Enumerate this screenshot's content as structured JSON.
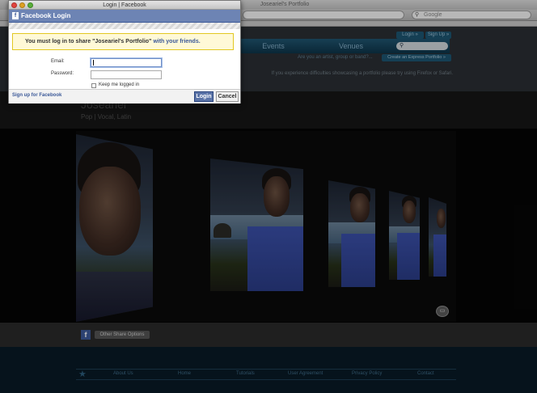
{
  "background": {
    "window_title": "Joseariel's Portfolio",
    "search_placeholder": "Google",
    "nav": {
      "events": "Events",
      "venues": "Venues"
    },
    "login_pill": "Login »",
    "signup_pill": "Sign Up »",
    "artist_prompt": "Are you an artist, group or band?...",
    "express_button": "Create an Express Portfolio »",
    "difficulties_text": "If you experience difficulties showcasing a portfolio please try using Firefox or Safari.",
    "profile_name": "Joseariel",
    "profile_genre": "Pop | Vocal, Latin",
    "share_options": "Other Share Options",
    "footer_links": [
      "About Us",
      "Home",
      "Tutorials",
      "User Agreement",
      "Privacy Policy",
      "Contact"
    ]
  },
  "popup": {
    "window_title": "Login | Facebook",
    "header_title": "Facebook Login",
    "notice_prefix": "You must log in to share \"Joseariel's Portfolio\"",
    "notice_link": "with your friends.",
    "email_label": "Email:",
    "password_label": "Password:",
    "email_value": "",
    "password_value": "",
    "keep_logged_in": "Keep me logged in",
    "signup_link": "Sign up for Facebook",
    "login_button": "Login",
    "cancel_button": "Cancel"
  },
  "colors": {
    "facebook_blue": "#3b5998",
    "header_blue": "#6d84b4",
    "notice_bg": "#fff9d7",
    "site_nav": "#1f5470"
  }
}
